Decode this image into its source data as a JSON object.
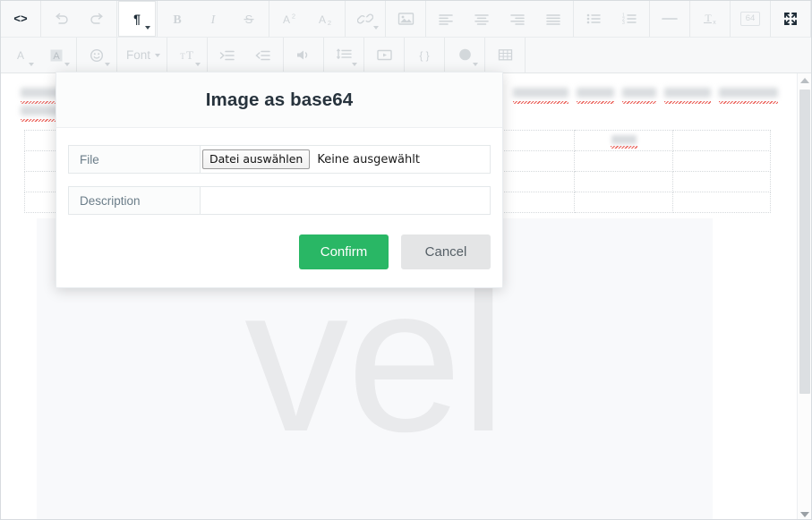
{
  "toolbar": {
    "row1": [
      {
        "group": 1,
        "name": "source-code-button",
        "icon": "code-icon",
        "label": "<>",
        "state": "dark"
      },
      {
        "group": 2,
        "name": "undo-button",
        "icon": "undo-icon",
        "label": "",
        "state": "disabled"
      },
      {
        "group": 2,
        "name": "redo-button",
        "icon": "redo-icon",
        "label": "",
        "state": "disabled"
      },
      {
        "group": 3,
        "name": "paragraph-format-button",
        "icon": "pilcrow-icon",
        "label": "",
        "state": "active"
      },
      {
        "group": 4,
        "name": "bold-button",
        "icon": "bold-icon",
        "label": "B",
        "state": "disabled"
      },
      {
        "group": 4,
        "name": "italic-button",
        "icon": "italic-icon",
        "label": "I",
        "state": "disabled"
      },
      {
        "group": 4,
        "name": "strikethrough-button",
        "icon": "strikethrough-icon",
        "label": "S",
        "state": "disabled"
      },
      {
        "group": 5,
        "name": "superscript-button",
        "icon": "superscript-icon",
        "label": "A2",
        "state": "disabled"
      },
      {
        "group": 5,
        "name": "subscript-button",
        "icon": "subscript-icon",
        "label": "A2",
        "state": "disabled"
      },
      {
        "group": 6,
        "name": "insert-link-button",
        "icon": "link-icon",
        "label": "",
        "state": "disabled"
      },
      {
        "group": 7,
        "name": "insert-image-button",
        "icon": "image-icon",
        "label": "",
        "state": "disabled"
      },
      {
        "group": 8,
        "name": "align-left-button",
        "icon": "align-left-icon",
        "label": "",
        "state": "disabled"
      },
      {
        "group": 8,
        "name": "align-center-button",
        "icon": "align-center-icon",
        "label": "",
        "state": "disabled"
      },
      {
        "group": 8,
        "name": "align-right-button",
        "icon": "align-right-icon",
        "label": "",
        "state": "disabled"
      },
      {
        "group": 8,
        "name": "align-justify-button",
        "icon": "align-justify-icon",
        "label": "",
        "state": "disabled"
      },
      {
        "group": 9,
        "name": "unordered-list-button",
        "icon": "bullet-list-icon",
        "label": "",
        "state": "disabled"
      },
      {
        "group": 9,
        "name": "ordered-list-button",
        "icon": "numbered-list-icon",
        "label": "",
        "state": "disabled"
      },
      {
        "group": 10,
        "name": "horizontal-rule-button",
        "icon": "horizontal-rule-icon",
        "label": "",
        "state": "disabled"
      },
      {
        "group": 11,
        "name": "clear-formatting-button",
        "icon": "clear-format-icon",
        "label": "Tx",
        "state": "disabled"
      },
      {
        "group": 12,
        "name": "base64-badge-button",
        "icon": "badge-64-icon",
        "label": "64",
        "state": "disabled"
      },
      {
        "group": 13,
        "name": "fullscreen-button",
        "icon": "fullscreen-icon",
        "label": "",
        "state": "dark"
      }
    ],
    "row2": [
      {
        "group": 1,
        "name": "text-color-button",
        "icon": "text-color-icon",
        "label": "A",
        "state": "disabled"
      },
      {
        "group": 1,
        "name": "background-color-button",
        "icon": "highlight-color-icon",
        "label": "A",
        "state": "disabled"
      },
      {
        "group": 2,
        "name": "emoticon-button",
        "icon": "emoji-icon",
        "label": "",
        "state": "disabled"
      },
      {
        "group": 3,
        "name": "font-family-dropdown",
        "icon": "font-icon",
        "label": "Font",
        "state": "disabled"
      },
      {
        "group": 4,
        "name": "font-size-button",
        "icon": "font-size-icon",
        "label": "",
        "state": "disabled"
      },
      {
        "group": 5,
        "name": "increase-indent-button",
        "icon": "indent-increase-icon",
        "label": "",
        "state": "disabled"
      },
      {
        "group": 5,
        "name": "decrease-indent-button",
        "icon": "indent-decrease-icon",
        "label": "",
        "state": "disabled"
      },
      {
        "group": 6,
        "name": "insert-audio-button",
        "icon": "audio-icon",
        "label": "",
        "state": "disabled"
      },
      {
        "group": 7,
        "name": "line-height-button",
        "icon": "line-height-icon",
        "label": "",
        "state": "disabled"
      },
      {
        "group": 8,
        "name": "insert-video-button",
        "icon": "video-icon",
        "label": "",
        "state": "disabled"
      },
      {
        "group": 9,
        "name": "code-block-button",
        "icon": "braces-icon",
        "label": "{ }",
        "state": "disabled"
      },
      {
        "group": 10,
        "name": "shape-color-button",
        "icon": "filled-circle-icon",
        "label": "",
        "state": "disabled"
      },
      {
        "group": 11,
        "name": "insert-table-button",
        "icon": "table-icon",
        "label": "",
        "state": "disabled"
      }
    ]
  },
  "editor": {
    "watermark_text": "vel",
    "blurred_placeholder": true
  },
  "dialog": {
    "title": "Image as base64",
    "fields": [
      {
        "label": "File",
        "type": "file",
        "button_label": "Datei auswählen",
        "status_text": "Keine ausgewählt"
      },
      {
        "label": "Description",
        "type": "text",
        "value": "",
        "placeholder": ""
      }
    ],
    "confirm_label": "Confirm",
    "cancel_label": "Cancel",
    "confirm_color": "#29b765",
    "cancel_color": "#e4e5e6"
  },
  "scrollbar": {
    "up_arrow": "scroll-up-arrow",
    "down_arrow": "scroll-down-arrow",
    "thumb_position_percent": 4,
    "thumb_size_percent": 70
  }
}
